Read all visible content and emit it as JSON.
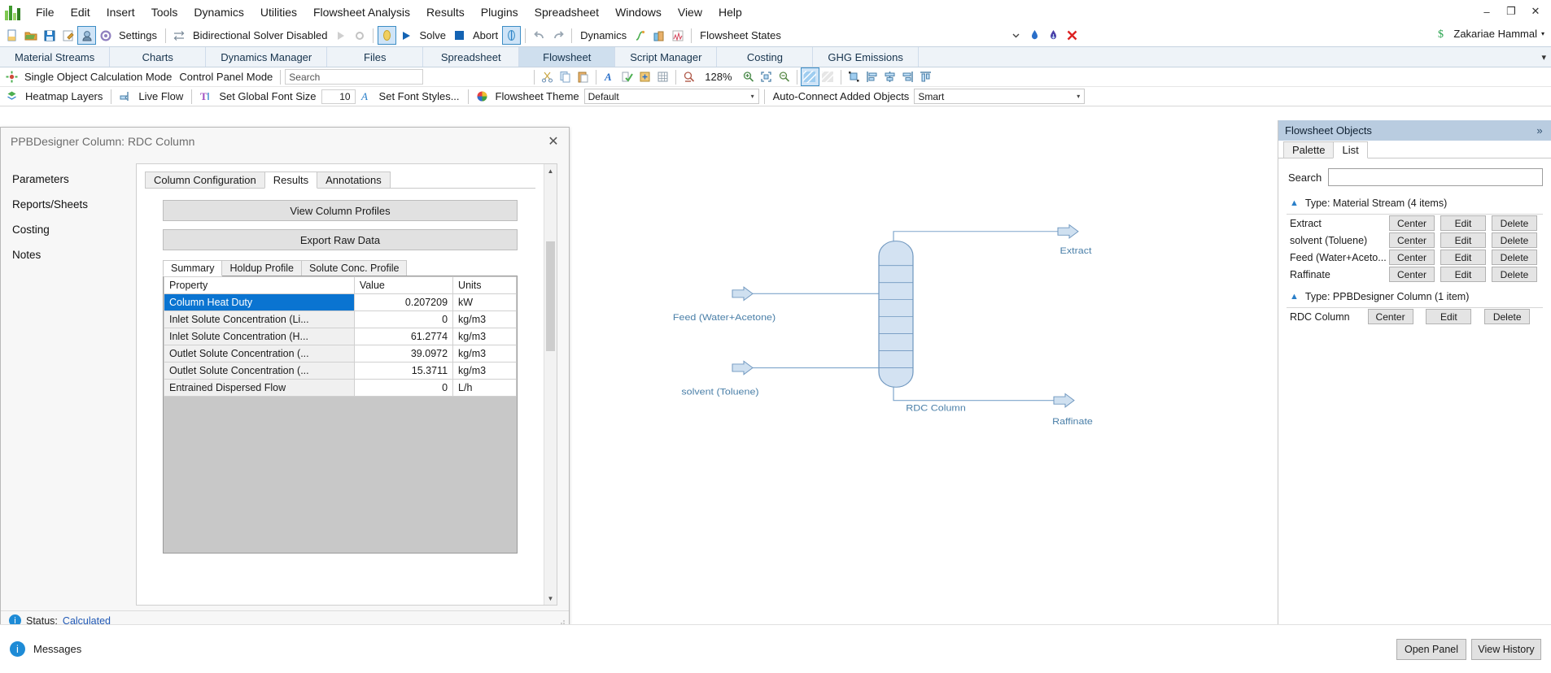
{
  "window": {
    "controls": {
      "minimize": "–",
      "restore": "❐",
      "close": "✕"
    }
  },
  "menubar": {
    "items": [
      "File",
      "Edit",
      "Insert",
      "Tools",
      "Dynamics",
      "Utilities",
      "Flowsheet Analysis",
      "Results",
      "Plugins",
      "Spreadsheet",
      "Windows",
      "View",
      "Help"
    ]
  },
  "toolbar_main": {
    "settings_label": "Settings",
    "solver_label": "Bidirectional Solver Disabled",
    "solve_label": "Solve",
    "abort_label": "Abort",
    "dynamics_label": "Dynamics",
    "flowsheet_states_label": "Flowsheet States",
    "user_name": "Zakariae Hammal"
  },
  "ribbon": {
    "tabs": [
      {
        "label": "Material Streams",
        "active": false
      },
      {
        "label": "Charts",
        "active": false
      },
      {
        "label": "Dynamics Manager",
        "active": false
      },
      {
        "label": "Files",
        "active": false
      },
      {
        "label": "Spreadsheet",
        "active": false
      },
      {
        "label": "Flowsheet",
        "active": true
      },
      {
        "label": "Script Manager",
        "active": false
      },
      {
        "label": "Costing",
        "active": false
      },
      {
        "label": "GHG Emissions",
        "active": false
      }
    ],
    "overflow": "▾"
  },
  "toolbar_flowsheet": {
    "single_object_mode": "Single Object Calculation Mode",
    "control_panel_mode": "Control Panel Mode",
    "search_placeholder": "Search",
    "search_value": "",
    "zoom_level": "128%"
  },
  "toolbar_style": {
    "heatmap_layers": "Heatmap Layers",
    "live_flow": "Live Flow",
    "set_global_font_size": "Set Global Font Size",
    "font_size_value": "10",
    "set_font_styles": "Set Font Styles...",
    "flowsheet_theme_label": "Flowsheet Theme",
    "flowsheet_theme_value": "Default",
    "auto_connect_label": "Auto-Connect Added Objects",
    "auto_connect_value": "Smart"
  },
  "dialog": {
    "title": "PPBDesigner Column: RDC Column",
    "close": "✕",
    "nav_items": [
      "Parameters",
      "Reports/Sheets",
      "Costing",
      "Notes"
    ],
    "tabs": [
      {
        "label": "Column Configuration",
        "active": false
      },
      {
        "label": "Results",
        "active": true
      },
      {
        "label": "Annotations",
        "active": false
      }
    ],
    "buttons": {
      "view_profiles": "View Column Profiles",
      "export_raw": "Export Raw Data"
    },
    "subtabs": [
      {
        "label": "Summary",
        "active": true
      },
      {
        "label": "Holdup Profile",
        "active": false
      },
      {
        "label": "Solute Conc. Profile",
        "active": false
      }
    ],
    "table": {
      "headers": [
        "Property",
        "Value",
        "Units"
      ],
      "rows": [
        {
          "property": "Column Heat Duty",
          "value": "0.207209",
          "units": "kW",
          "selected": true
        },
        {
          "property": "Inlet Solute Concentration (Li...",
          "value": "0",
          "units": "kg/m3",
          "selected": false
        },
        {
          "property": "Inlet Solute Concentration (H...",
          "value": "61.2774",
          "units": "kg/m3",
          "selected": false
        },
        {
          "property": "Outlet Solute Concentration (...",
          "value": "39.0972",
          "units": "kg/m3",
          "selected": false
        },
        {
          "property": "Outlet Solute Concentration (...",
          "value": "15.3711",
          "units": "kg/m3",
          "selected": false
        },
        {
          "property": "Entrained Dispersed Flow",
          "value": "0",
          "units": "L/h",
          "selected": false
        }
      ]
    },
    "status_label": "Status:",
    "status_value": "Calculated"
  },
  "flowsheet": {
    "labels": {
      "feed": "Feed (Water+Acetone)",
      "solvent": "solvent (Toluene)",
      "extract": "Extract",
      "raffinate": "Raffinate",
      "column": "RDC Column"
    },
    "accent_color": "#5b86b5",
    "fill_color": "#d3e2f2"
  },
  "right_panel": {
    "header": "Flowsheet Objects",
    "collapse": "»",
    "tabs": [
      {
        "label": "Palette",
        "active": false
      },
      {
        "label": "List",
        "active": true
      }
    ],
    "search_label": "Search",
    "search_value": "",
    "groups": [
      {
        "title": "Type: Material Stream (4 items)",
        "items": [
          {
            "name": "Extract",
            "actions": [
              "Center",
              "Edit",
              "Delete"
            ]
          },
          {
            "name": "solvent (Toluene)",
            "actions": [
              "Center",
              "Edit",
              "Delete"
            ]
          },
          {
            "name": "Feed (Water+Aceto...",
            "actions": [
              "Center",
              "Edit",
              "Delete"
            ]
          },
          {
            "name": "Raffinate",
            "actions": [
              "Center",
              "Edit",
              "Delete"
            ]
          }
        ]
      },
      {
        "title": "Type: PPBDesigner Column (1 item)",
        "items": [
          {
            "name": "RDC Column",
            "actions": [
              "Center",
              "Edit",
              "Delete"
            ]
          }
        ]
      }
    ]
  },
  "bottom_bar": {
    "messages_label": "Messages",
    "open_panel": "Open Panel",
    "view_history": "View History"
  }
}
